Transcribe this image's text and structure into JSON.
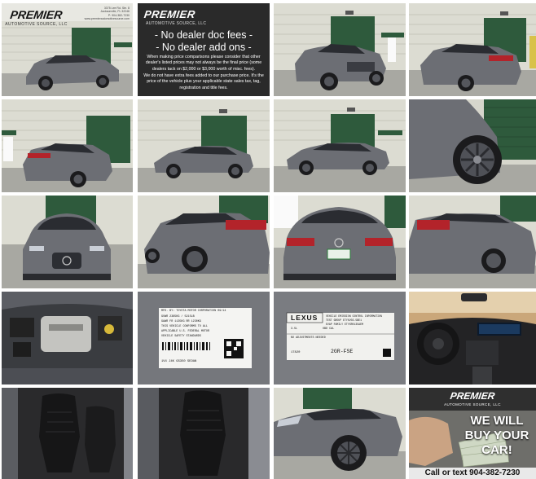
{
  "dealer": {
    "logo_text": "PREMIER",
    "logo_subtitle": "AUTOMOTIVE SOURCE, LLC",
    "address_lines": [
      "3375 Lee Rd. Ste. 8",
      "Jacksonville, FL 32246",
      "P: 904-382-7230",
      "www.premierautomotivesource.com"
    ]
  },
  "fees_banner": {
    "headline_1": "- No dealer doc fees -",
    "headline_2": "- No dealer add ons -",
    "paragraph_1": "When making price comparisons please consider that other dealer's listed prices may not always be the final price (some dealers tack on $2,000 or $3,000 worth of misc. fees).",
    "paragraph_2": "We do not have extra fees added to our purchase price. It's the price of the vehicle plus your applicable state sales tax, tag, registration and title fees."
  },
  "buy_card": {
    "line_1": "WE WILL",
    "line_2": "BUY YOUR",
    "line_3": "CAR!",
    "call": "Call or text 904-382-7230"
  },
  "emissions_label": {
    "brand": "LEXUS",
    "engine_code": "2GR-FSE",
    "footer_code": "17820",
    "rows": [
      "VEHICLE EMISSION CONTROL INFORMATION",
      "TEST GROUP ETYXV03.5BE1",
      "EVAP FAMILY ETYXR0135AEM",
      "3.5L",
      "OBD CAL",
      "NO ADJUSTMENTS NEEDED"
    ]
  },
  "vin_label": {
    "manufacturer_line": "MFD. BY: TOYOTA MOTOR CORPORATION   09/14",
    "rows": [
      "GVWR 2365KG / 5215LB",
      "GAWR FR 1135KG   RR 1230KG",
      "THIS VEHICLE CONFORMS TO ALL",
      "APPLICABLE U.S. FEDERAL MOTOR",
      "VEHICLE SAFETY STANDARDS"
    ],
    "footer": "1V4 J4K   GS350   SEDAN"
  },
  "vehicle": {
    "color_body": "#707278",
    "color_body_dark": "#4a4c52",
    "color_interior": "#1f1f21"
  },
  "photos": [
    {
      "kind": "logo-card",
      "alt": "dealer logo with front three-quarter view"
    },
    {
      "kind": "fees-banner"
    },
    {
      "kind": "exterior",
      "view": "front-3q-left"
    },
    {
      "kind": "exterior",
      "view": "rear-3q-right"
    },
    {
      "kind": "exterior",
      "view": "rear-3q-left"
    },
    {
      "kind": "exterior",
      "view": "side-left"
    },
    {
      "kind": "exterior",
      "view": "side-left-wide"
    },
    {
      "kind": "detail",
      "view": "front-wheel"
    },
    {
      "kind": "exterior",
      "view": "front"
    },
    {
      "kind": "exterior",
      "view": "rear-3q-left-close"
    },
    {
      "kind": "exterior",
      "view": "rear"
    },
    {
      "kind": "exterior",
      "view": "rear-3q-right-close"
    },
    {
      "kind": "engine"
    },
    {
      "kind": "vin-label"
    },
    {
      "kind": "emissions-label"
    },
    {
      "kind": "dashboard"
    },
    {
      "kind": "interior",
      "view": "front-seats"
    },
    {
      "kind": "interior",
      "view": "driver-seat"
    },
    {
      "kind": "detail",
      "view": "headlight-wheel"
    },
    {
      "kind": "buy-card"
    }
  ]
}
